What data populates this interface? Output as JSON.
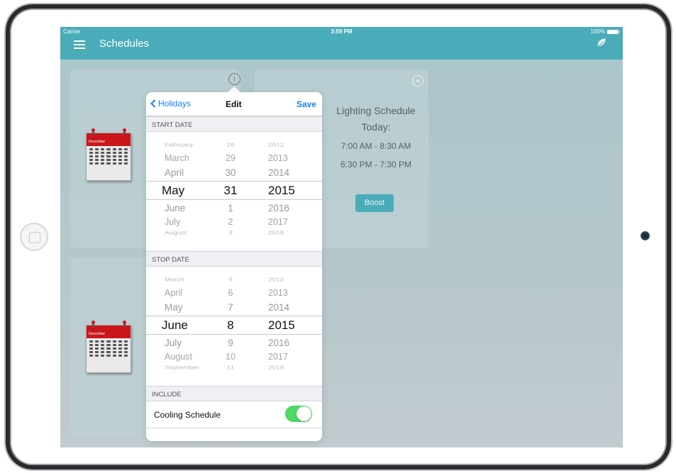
{
  "status_bar": {
    "carrier": "Carrier",
    "time": "3:59 PM",
    "battery": "100%"
  },
  "navbar": {
    "title": "Schedules",
    "menu_icon": "hamburger-menu-icon",
    "right_icon": "leaf-icon"
  },
  "cards": {
    "calendar_month": "December",
    "lighting": {
      "title": "Lighting Schedule",
      "today_label": "Today:",
      "slots": [
        "7:00 AM - 8:30 AM",
        "6:30 PM - 7:30 PM"
      ],
      "boost_label": "Boost"
    }
  },
  "popover": {
    "back_label": "Holidays",
    "title": "Edit",
    "save_label": "Save",
    "start_date": {
      "header": "START DATE",
      "months": [
        "",
        "February",
        "March",
        "April",
        "May",
        "June",
        "July",
        "August",
        ""
      ],
      "days": [
        "",
        "28",
        "29",
        "30",
        "31",
        "1",
        "2",
        "3",
        ""
      ],
      "years": [
        "",
        "2012",
        "2013",
        "2014",
        "2015",
        "2016",
        "2017",
        "2018",
        ""
      ],
      "selected": {
        "month": "May",
        "day": "31",
        "year": "2015"
      }
    },
    "stop_date": {
      "header": "STOP DATE",
      "months": [
        "",
        "March",
        "April",
        "May",
        "June",
        "July",
        "August",
        "September",
        ""
      ],
      "days": [
        "",
        "5",
        "6",
        "7",
        "8",
        "9",
        "10",
        "11",
        ""
      ],
      "years": [
        "",
        "2012",
        "2013",
        "2014",
        "2015",
        "2016",
        "2017",
        "2018",
        ""
      ],
      "selected": {
        "month": "June",
        "day": "8",
        "year": "2015"
      }
    },
    "include": {
      "header": "INCLUDE",
      "cooling_label": "Cooling Schedule",
      "cooling_enabled": true
    }
  },
  "colors": {
    "navbar": "#4aacb9",
    "accent_blue": "#147efb",
    "toggle_on": "#4cd964",
    "calendar_red": "#c9161b"
  }
}
